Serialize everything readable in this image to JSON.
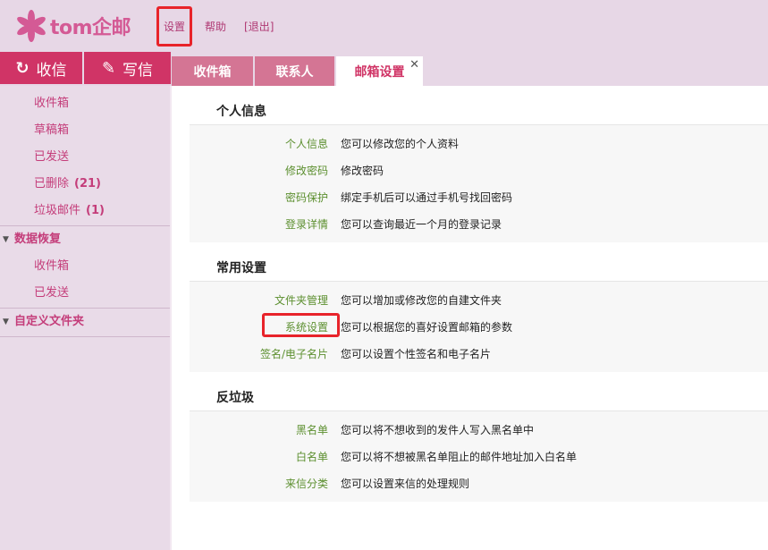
{
  "header": {
    "logo_text": "tom企邮",
    "links": [
      "设置",
      "帮助",
      "[退出]"
    ]
  },
  "toolbar": {
    "receive_label": "收信",
    "write_label": "写信"
  },
  "tabs": [
    "收件箱",
    "联系人",
    "邮箱设置"
  ],
  "sidebar": {
    "folders": [
      {
        "label": "收件箱",
        "count": ""
      },
      {
        "label": "草稿箱",
        "count": ""
      },
      {
        "label": "已发送",
        "count": ""
      },
      {
        "label": "已删除",
        "count": "(21)"
      },
      {
        "label": "垃圾邮件",
        "count": "(1)"
      }
    ],
    "recovery_group": "数据恢复",
    "recovery_items": [
      "收件箱",
      "已发送"
    ],
    "custom_group": "自定义文件夹"
  },
  "sections": [
    {
      "title": "个人信息",
      "rows": [
        {
          "label": "个人信息",
          "desc": "您可以修改您的个人资料"
        },
        {
          "label": "修改密码",
          "desc": "修改密码"
        },
        {
          "label": "密码保护",
          "desc": "绑定手机后可以通过手机号找回密码"
        },
        {
          "label": "登录详情",
          "desc": "您可以查询最近一个月的登录记录"
        }
      ]
    },
    {
      "title": "常用设置",
      "rows": [
        {
          "label": "文件夹管理",
          "desc": "您可以增加或修改您的自建文件夹"
        },
        {
          "label": "系统设置",
          "desc": "您可以根据您的喜好设置邮箱的参数"
        },
        {
          "label": "签名/电子名片",
          "desc": "您可以设置个性签名和电子名片"
        }
      ]
    },
    {
      "title": "反垃圾",
      "rows": [
        {
          "label": "黑名单",
          "desc": "您可以将不想收到的发件人写入黑名单中"
        },
        {
          "label": "白名单",
          "desc": "您可以将不想被黑名单阻止的邮件地址加入白名单"
        },
        {
          "label": "来信分类",
          "desc": "您可以设置来信的处理规则"
        }
      ]
    }
  ],
  "colors": {
    "brand": "#d03466",
    "header_bg": "#e7d7e6",
    "link_green": "#5c8f2f",
    "highlight_red": "#e8232a"
  }
}
